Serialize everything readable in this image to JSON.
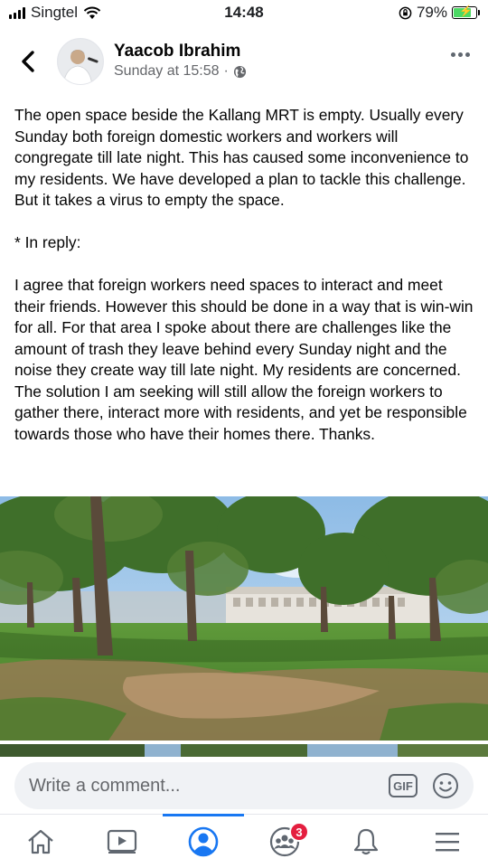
{
  "status_bar": {
    "carrier": "Singtel",
    "time": "14:48",
    "battery": "79%",
    "battery_level": 0.79
  },
  "post": {
    "author": "Yaacob Ibrahim",
    "timestamp": "Sunday at 15:58",
    "separator": "·",
    "paragraphs": [
      "The open space beside the Kallang MRT is empty. Usually every Sunday both foreign domestic workers and workers will congregate till late night. This has caused some inconvenience to my residents. We have developed a plan to tackle this challenge. But it takes a virus to empty the space.",
      "* In reply:",
      "I agree that foreign workers need spaces to interact and meet their friends. However this should be done in a way that is win-win for all. For that area I spoke about there are challenges like the amount of trash they leave behind every Sunday night and the noise they create way till late night. My residents are concerned. The solution I am seeking will still allow the foreign workers to gather there, interact more with residents, and yet be responsible towards those who have their homes there. Thanks."
    ]
  },
  "comment": {
    "placeholder": "Write a comment...",
    "gif_label": "GIF"
  },
  "nav": {
    "groups_badge": "3",
    "active_tab": "profile"
  },
  "icons": {
    "back": "chevron-left-icon",
    "privacy": "globe-icon",
    "more": "more-horizontal-icon",
    "emoji": "smiley-icon",
    "home": "home-icon",
    "watch": "video-icon",
    "profile": "profile-icon",
    "groups": "groups-icon",
    "notifications": "bell-icon",
    "menu": "menu-icon"
  },
  "colors": {
    "accent": "#1877f2",
    "badge": "#e41e3f"
  }
}
